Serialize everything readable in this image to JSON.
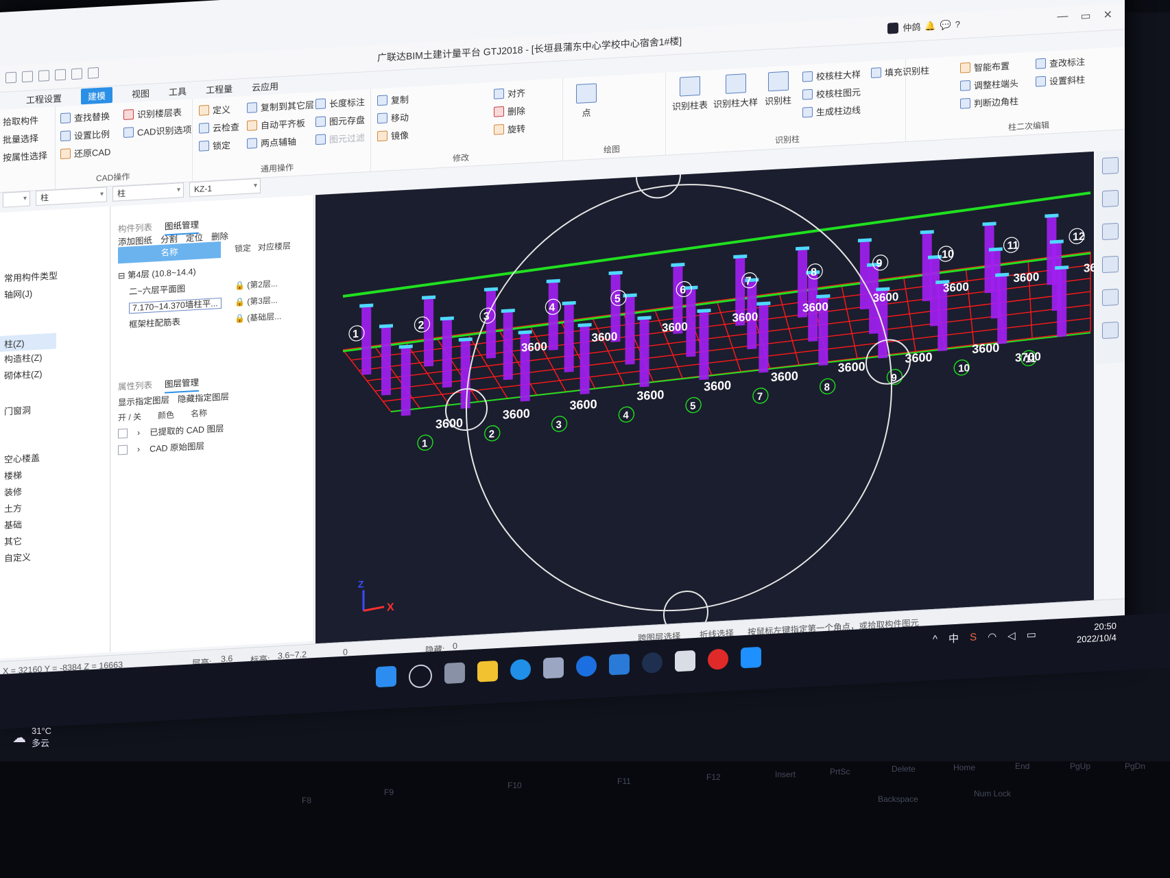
{
  "window": {
    "title": "广联达BIM土建计量平台 GTJ2018 - [长垣县蒲东中心学校中心宿舍1#楼]",
    "user": "仲鸽",
    "controls": [
      "—",
      "▭",
      "✕"
    ]
  },
  "menu": {
    "items": [
      "工程设置",
      "建模",
      "视图",
      "工具",
      "工程量",
      "云应用"
    ],
    "active": "建模"
  },
  "ribbon": {
    "select_group": [
      "拾取构件",
      "批量选择",
      "按属性选择"
    ],
    "cad_group": {
      "items": [
        "查找替换",
        "设置比例",
        "还原CAD",
        "识别楼层表",
        "CAD识别选项"
      ],
      "label": "CAD操作"
    },
    "common_group": {
      "items": [
        "定义",
        "云检查",
        "锁定",
        "复制到其它层",
        "自动平齐板",
        "两点辅轴",
        "长度标注",
        "图元存盘",
        "图元过滤"
      ],
      "label": "通用操作"
    },
    "modify_group": {
      "items": [
        "复制",
        "移动",
        "镜像",
        "对齐",
        "删除",
        "旋转"
      ],
      "label": "修改"
    },
    "draw_group": {
      "items": [
        "点"
      ],
      "label": "绘图"
    },
    "identify_group": {
      "items": [
        "识别柱表",
        "识别柱大样",
        "识别柱",
        "校核柱大样",
        "校核柱图元",
        "生成柱边线",
        "填充识别柱"
      ],
      "label": "识别柱"
    },
    "column_edit_group": {
      "items": [
        "智能布置",
        "调整柱端头",
        "判断边角柱",
        "查改标注",
        "设置斜柱"
      ],
      "label": "柱二次编辑"
    }
  },
  "selectors": {
    "category": "柱",
    "type": "柱",
    "name": "KZ-1"
  },
  "sidebar": {
    "items": [
      "常用构件类型",
      "轴网(J)",
      "柱(Z)",
      "构造柱(Z)",
      "砌体柱(Z)",
      "门窗洞",
      "空心楼盖",
      "楼梯",
      "装修",
      "土方",
      "基础",
      "其它",
      "自定义"
    ],
    "selected": "柱(Z)"
  },
  "drawing_panel": {
    "tabs": [
      "构件列表",
      "图纸管理"
    ],
    "active_tab": "图纸管理",
    "toolbar": [
      "添加图纸",
      "分割",
      "定位",
      "删除"
    ],
    "columns": [
      "名称",
      "锁定",
      "对应楼层"
    ],
    "rows": [
      {
        "name": "第4层 (10.8~14.4)",
        "floor": "(第2层..."
      },
      {
        "name": "二~六层平面图",
        "floor": "(第3层..."
      },
      {
        "name": "7.170~14.370墙柱平...",
        "floor": "(基础层..."
      },
      {
        "name": "框架柱配筋表",
        "floor": ""
      }
    ]
  },
  "layer_panel": {
    "tabs": [
      "属性列表",
      "图层管理"
    ],
    "active_tab": "图层管理",
    "toolbar": [
      "显示指定图层",
      "隐藏指定图层"
    ],
    "columns": [
      "开 / 关",
      "颜色",
      "名称"
    ],
    "rows": [
      "已提取的 CAD 图层",
      "CAD 原始图层"
    ]
  },
  "viewport": {
    "axis_numbers_back": [
      "1",
      "2",
      "3",
      "4",
      "5",
      "6",
      "7",
      "8",
      "9",
      "10",
      "11",
      "12"
    ],
    "axis_numbers_front": [
      "1",
      "2",
      "3",
      "4",
      "5",
      "7",
      "8",
      "9",
      "10",
      "11"
    ],
    "span_label": "3600",
    "span_label_alt": "3700",
    "axis_x": "X",
    "axis_z": "Z"
  },
  "status": {
    "coords": "X = 32160 Y = -8384 Z = 16663",
    "floor_height_label": "层高:",
    "floor_height": "3.6",
    "elevation_label": "标高:",
    "elevation": "3.6~7.2",
    "zero": "0",
    "hidden_label": "隐藏:",
    "hidden": "0",
    "modes": [
      "跨图层选择",
      "折线选择"
    ],
    "hint": "按鼠标左键指定第一个角点，或拾取构件图元"
  },
  "taskbar": {
    "time": "20:50",
    "date": "2022/10/4",
    "ime": "中",
    "weather_temp": "31°C",
    "weather_desc": "多云"
  },
  "keyboard": {
    "keys": [
      "F8",
      "F9",
      "F10",
      "F11",
      "F12",
      "Insert",
      "PrtSc",
      "Delete",
      "Home",
      "End",
      "PgUp",
      "PgDn",
      "Backspace",
      "Num Lock"
    ]
  },
  "colors": {
    "accent": "#2b8fe6",
    "viewport_bg": "#1b1e2e",
    "grid_red": "#ff1a1a",
    "grid_green": "#20e020",
    "column_purple": "#a020f0"
  }
}
